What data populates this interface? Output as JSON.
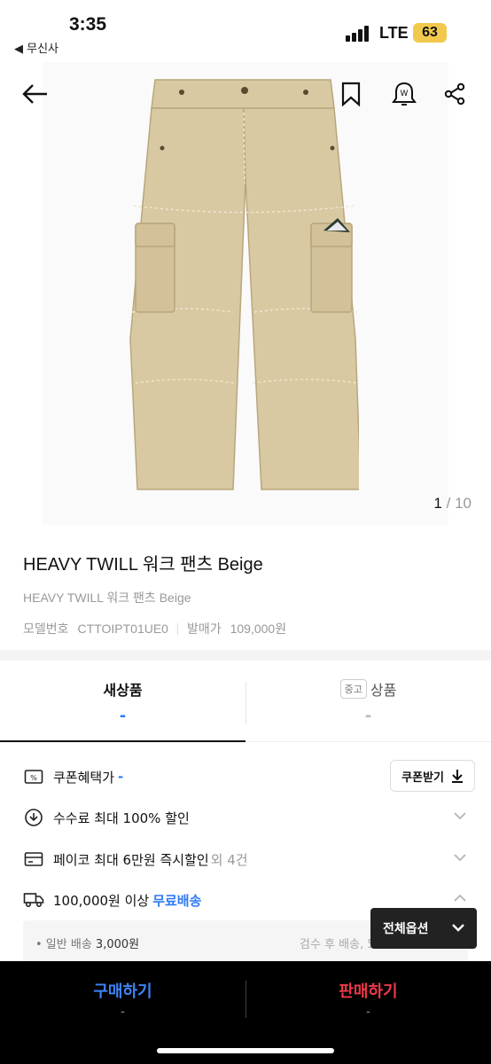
{
  "status_bar": {
    "time": "3:35",
    "back_app": "◀ 무신사",
    "network": "LTE",
    "battery": "63"
  },
  "gallery": {
    "current": "1",
    "separator": "/",
    "total": "10"
  },
  "product": {
    "title": "HEAVY TWILL 워크 팬츠 Beige",
    "subtitle": "HEAVY TWILL 워크 팬츠 Beige",
    "model_label": "모델번호",
    "model_value": "CTTOIPT01UE0",
    "release_label": "발매가",
    "release_value": "109,000원"
  },
  "tabs": {
    "new": {
      "label": "새상품",
      "value": "-"
    },
    "used": {
      "badge": "중고",
      "label": "상품",
      "value": "-"
    }
  },
  "benefits": {
    "coupon": {
      "label": "쿠폰혜택가",
      "value": "-",
      "button": "쿠폰받기"
    },
    "fee": {
      "label": "수수료 최대 100% 할인"
    },
    "payco": {
      "label": "페이코 최대 6만원 즉시할인",
      "extra": "외 4건"
    },
    "shipping": {
      "label": "100,000원 이상",
      "highlight": "무료배송"
    }
  },
  "shipping_detail": {
    "left_label": "• 일반 배송",
    "left_value": "3,000원",
    "right_text": "검수 후 배송, 5"
  },
  "all_options_button": "전체옵션",
  "bottom_bar": {
    "buy": {
      "label": "구매하기",
      "sub": "-"
    },
    "sell": {
      "label": "판매하기",
      "sub": "-"
    }
  },
  "colors": {
    "accent_blue": "#2f7bf5",
    "buy_blue": "#3c84f7",
    "sell_red": "#f0384a",
    "pants_beige": "#d9c9a2"
  }
}
